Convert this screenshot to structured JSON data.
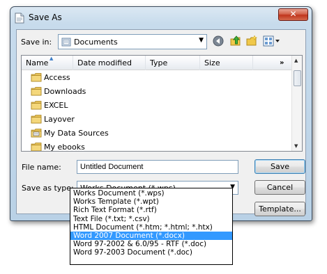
{
  "window": {
    "title": "Save As"
  },
  "toolbar": {
    "save_in_label": "Save in:",
    "save_in_value": "Documents"
  },
  "columns": [
    {
      "label": "Name"
    },
    {
      "label": "Date modified"
    },
    {
      "label": "Type"
    },
    {
      "label": "Size"
    }
  ],
  "more_columns_glyph": "»",
  "files": [
    {
      "name": "Access",
      "icon": "folder-icon"
    },
    {
      "name": "Downloads",
      "icon": "folder-icon"
    },
    {
      "name": "EXCEL",
      "icon": "folder-icon"
    },
    {
      "name": "Layover",
      "icon": "folder-icon"
    },
    {
      "name": "My Data Sources",
      "icon": "data-sources-folder-icon"
    },
    {
      "name": "My ebooks",
      "icon": "folder-icon"
    }
  ],
  "form": {
    "filename_label": "File name:",
    "filename_value": "Untitled Document",
    "save_type_label": "Save as type:",
    "save_type_value": "Works Document (*.wps)"
  },
  "buttons": {
    "save": "Save",
    "cancel": "Cancel",
    "template": "Template..."
  },
  "save_type_options": [
    "Works Document (*.wps)",
    "Works Template (*.wpt)",
    "Rich Text Format (*.rtf)",
    "Text File (*.txt; *.csv)",
    "HTML Document (*.htm; *.html; *.htx)",
    "Word 2007 Document (*.docx)",
    "Word 97-2002 & 6.0/95 - RTF (*.doc)",
    "Word 97-2003 Document (*.doc)"
  ],
  "selected_option": "Word 2007 Document (*.docx)",
  "colors": {
    "accent_selection": "#3399ff",
    "close_button": "#c0351d",
    "folder": "#e8c35a"
  }
}
